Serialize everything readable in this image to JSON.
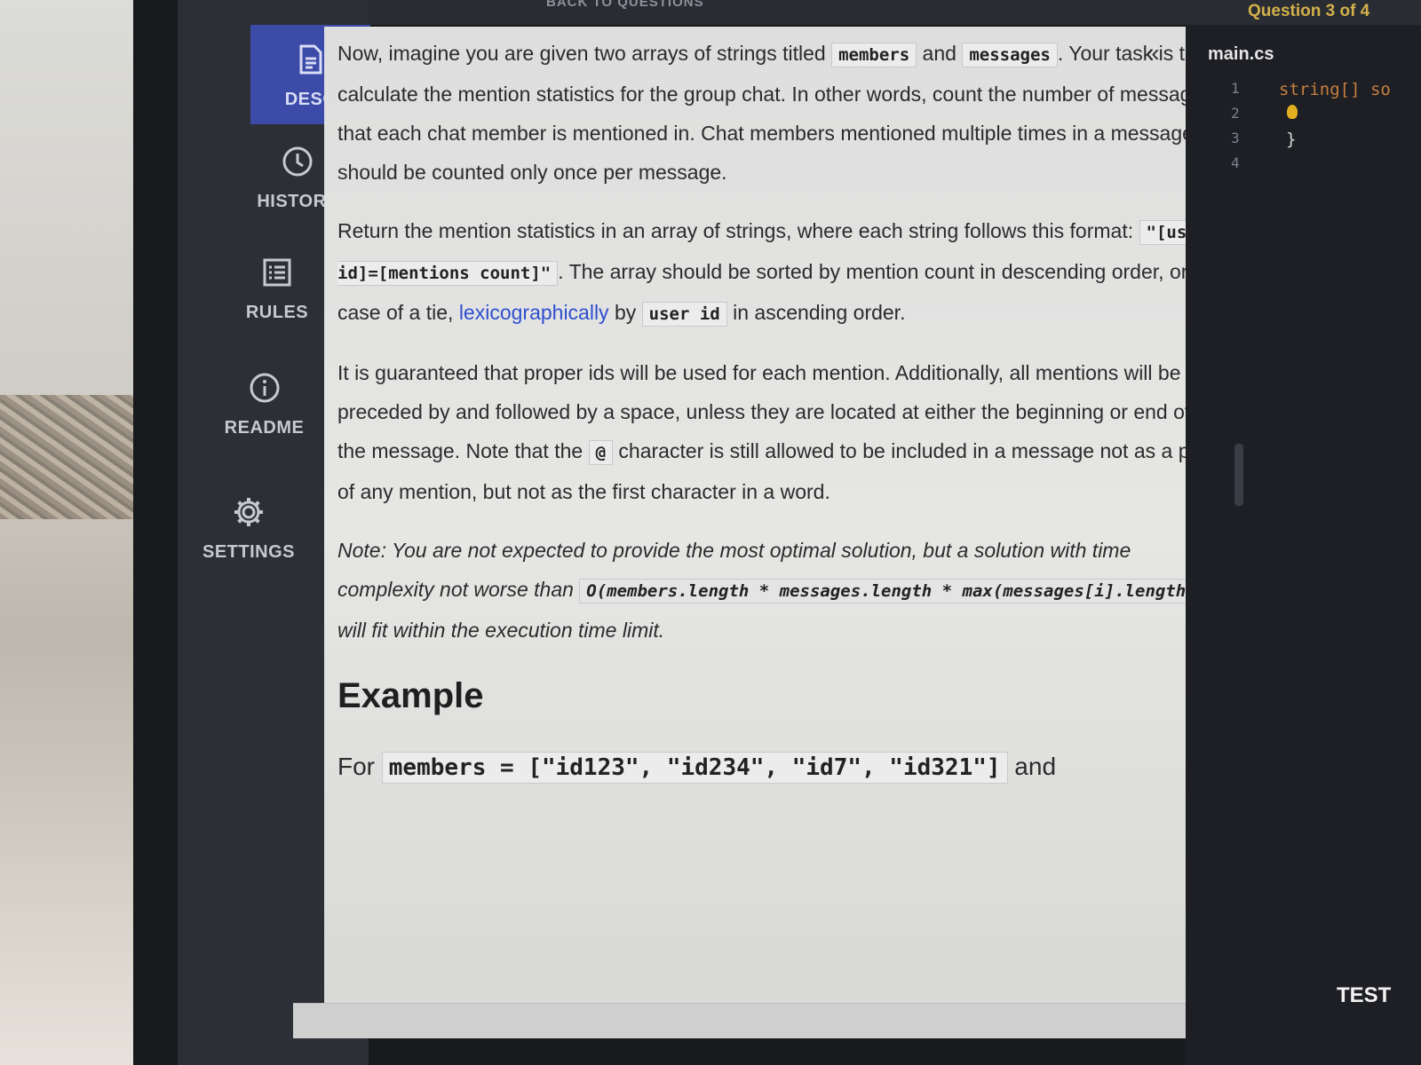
{
  "header": {
    "back_label": "BACK TO QUESTIONS",
    "question_counter": "Question 3 of 4"
  },
  "sidebar": {
    "items": [
      {
        "label": "DESC",
        "icon": "document-icon",
        "active": true
      },
      {
        "label": "HISTORY",
        "icon": "clock-icon"
      },
      {
        "label": "RULES",
        "icon": "list-icon"
      },
      {
        "label": "README",
        "icon": "info-icon"
      },
      {
        "label": "SETTINGS",
        "icon": "gear-icon"
      }
    ]
  },
  "description": {
    "p1": {
      "t1": "Now, imagine you are given two arrays of strings titled ",
      "c1": "members",
      "t2": " and ",
      "c2": "messages",
      "t3": ". Your task is to calculate the mention statistics for the group chat. In other words, count the number of messages that each chat member is mentioned in. Chat members mentioned multiple times in a message should be counted only once per message."
    },
    "p2": {
      "t1": "Return the mention statistics in an array of strings, where each string follows this format: ",
      "c1": "\"[user id]=[mentions count]\"",
      "t2": ". The array should be sorted by mention count in descending order, or in case of a tie, ",
      "link": "lexicographically",
      "t3": " by ",
      "c2": "user id",
      "t4": " in ascending order."
    },
    "p3": {
      "t1": "It is guaranteed that proper ids will be used for each mention. Additionally, all mentions will be preceded by and followed by a space, unless they are located at either the beginning or end of the message. Note that the ",
      "c1": "@",
      "t2": " character is still allowed to be included in a message not as a part of any mention, but not as the first character in a word."
    },
    "note": {
      "t1": "Note: You are not expected to provide the most optimal solution, but a solution with time complexity not worse than ",
      "c1": "O(members.length * messages.length * max(messages[i].length))",
      "t2": " will fit within the execution time limit."
    },
    "example_heading": "Example",
    "example": {
      "t1": "For ",
      "c1": "members = [\"id123\", \"id234\", \"id7\", \"id321\"]",
      "t2": " and"
    },
    "collapse_icon": "double-chevron-left-icon"
  },
  "editor": {
    "filename": "main.cs",
    "line_numbers": [
      "1",
      "2",
      "3",
      "4"
    ],
    "lines": [
      "string[] so",
      "",
      "}",
      ""
    ],
    "test_label": "TEST"
  }
}
